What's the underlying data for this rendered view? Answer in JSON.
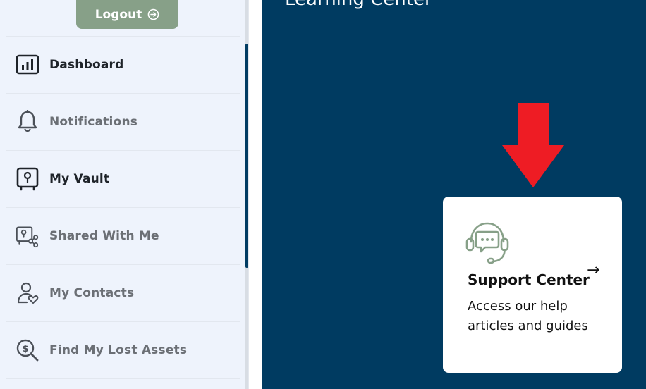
{
  "logout": {
    "label": "Logout",
    "icon": "logout-arrow-icon"
  },
  "sidebar": {
    "items": [
      {
        "label": "Dashboard",
        "icon": "bar-chart-icon"
      },
      {
        "label": "Notifications",
        "icon": "bell-icon"
      },
      {
        "label": "My Vault",
        "icon": "vault-icon"
      },
      {
        "label": "Shared With Me",
        "icon": "shared-icon"
      },
      {
        "label": "My Contacts",
        "icon": "contact-heart-icon"
      },
      {
        "label": "Find My Lost Assets",
        "icon": "search-dollar-icon"
      }
    ]
  },
  "main": {
    "title": "Learning Center",
    "card": {
      "title": "Support Center",
      "description": "Access our help articles and guides",
      "arrow": "→",
      "icon": "headset-chat-icon"
    }
  },
  "colors": {
    "sidebar_bg": "#eef3fc",
    "main_bg": "#003b61",
    "logout_bg": "#87a088",
    "callout_arrow": "#ee1c24",
    "card_icon": "#87a088"
  }
}
